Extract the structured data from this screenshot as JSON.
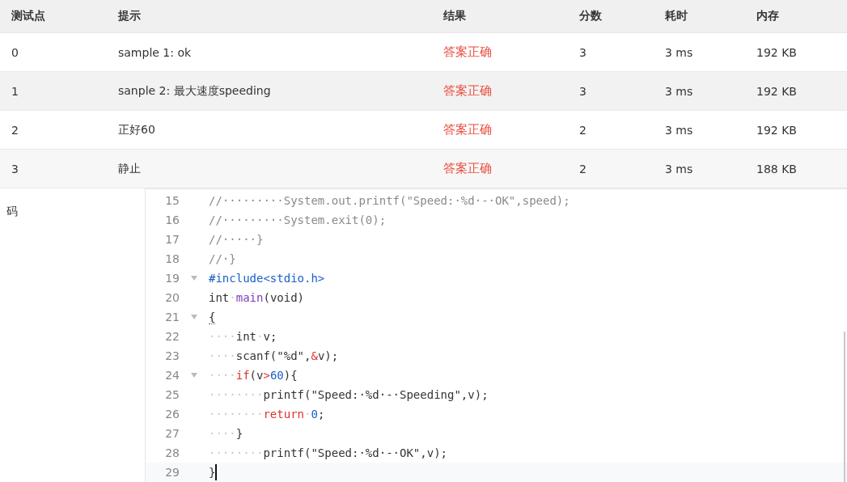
{
  "table": {
    "columns": [
      "测试点",
      "提示",
      "结果",
      "分数",
      "耗时",
      "内存"
    ],
    "rows": [
      {
        "cells": [
          "0",
          "sample 1: ok",
          "答案正确",
          "3",
          "3 ms",
          "192 KB"
        ]
      },
      {
        "cells": [
          "1",
          "sanple 2: 最大速度speeding",
          "答案正确",
          "3",
          "3 ms",
          "192 KB"
        ]
      },
      {
        "cells": [
          "2",
          "正好60",
          "答案正确",
          "2",
          "3 ms",
          "192 KB"
        ]
      },
      {
        "cells": [
          "3",
          "静止",
          "答案正确",
          "2",
          "3 ms",
          "188 KB"
        ]
      }
    ]
  },
  "code_label": "码",
  "editor": {
    "lines": [
      {
        "number": "15",
        "fold": false,
        "active": false,
        "tokens": [
          {
            "kind": "comment",
            "text": "//·········System.out.printf(\"Speed:·%d·-·OK\",speed);"
          }
        ]
      },
      {
        "number": "16",
        "fold": false,
        "active": false,
        "tokens": [
          {
            "kind": "comment",
            "text": "//·········System.exit(0);"
          }
        ]
      },
      {
        "number": "17",
        "fold": false,
        "active": false,
        "tokens": [
          {
            "kind": "comment",
            "text": "//·····}"
          }
        ]
      },
      {
        "number": "18",
        "fold": false,
        "active": false,
        "tokens": [
          {
            "kind": "comment",
            "text": "//·}"
          }
        ]
      },
      {
        "number": "19",
        "fold": true,
        "active": false,
        "tokens": [
          {
            "kind": "preproc",
            "text": "#include<stdio.h>"
          }
        ]
      },
      {
        "number": "20",
        "fold": false,
        "active": false,
        "tokens": [
          {
            "kind": "plain",
            "text": "int"
          },
          {
            "kind": "space",
            "text": "·"
          },
          {
            "kind": "function",
            "text": "main"
          },
          {
            "kind": "plain",
            "text": "(void)"
          }
        ]
      },
      {
        "number": "21",
        "fold": true,
        "active": false,
        "tokens": [
          {
            "kind": "bracket",
            "text": "{"
          }
        ]
      },
      {
        "number": "22",
        "fold": false,
        "active": false,
        "tokens": [
          {
            "kind": "space",
            "text": "····"
          },
          {
            "kind": "plain",
            "text": "int"
          },
          {
            "kind": "space",
            "text": "·"
          },
          {
            "kind": "plain",
            "text": "v;"
          }
        ]
      },
      {
        "number": "23",
        "fold": false,
        "active": false,
        "tokens": [
          {
            "kind": "space",
            "text": "····"
          },
          {
            "kind": "plain",
            "text": "scanf(\"%d\","
          },
          {
            "kind": "keyword",
            "text": "&"
          },
          {
            "kind": "plain",
            "text": "v);"
          }
        ]
      },
      {
        "number": "24",
        "fold": true,
        "active": false,
        "tokens": [
          {
            "kind": "space",
            "text": "····"
          },
          {
            "kind": "keyword",
            "text": "if"
          },
          {
            "kind": "plain",
            "text": "(v"
          },
          {
            "kind": "keyword",
            "text": ">"
          },
          {
            "kind": "number",
            "text": "60"
          },
          {
            "kind": "plain",
            "text": "){"
          }
        ]
      },
      {
        "number": "25",
        "fold": false,
        "active": false,
        "tokens": [
          {
            "kind": "space",
            "text": "········"
          },
          {
            "kind": "plain",
            "text": "printf(\"Speed:·%d·-·Speeding\",v);"
          }
        ]
      },
      {
        "number": "26",
        "fold": false,
        "active": false,
        "tokens": [
          {
            "kind": "space",
            "text": "········"
          },
          {
            "kind": "keyword",
            "text": "return"
          },
          {
            "kind": "space",
            "text": "·"
          },
          {
            "kind": "number",
            "text": "0"
          },
          {
            "kind": "plain",
            "text": ";"
          }
        ]
      },
      {
        "number": "27",
        "fold": false,
        "active": false,
        "tokens": [
          {
            "kind": "space",
            "text": "····"
          },
          {
            "kind": "plain",
            "text": "}"
          }
        ]
      },
      {
        "number": "28",
        "fold": false,
        "active": false,
        "tokens": [
          {
            "kind": "space",
            "text": "········"
          },
          {
            "kind": "plain",
            "text": "printf(\"Speed:·%d·-·OK\",v);"
          }
        ]
      },
      {
        "number": "29",
        "fold": false,
        "active": true,
        "tokens": [
          {
            "kind": "plain",
            "text": "}"
          }
        ]
      }
    ]
  }
}
